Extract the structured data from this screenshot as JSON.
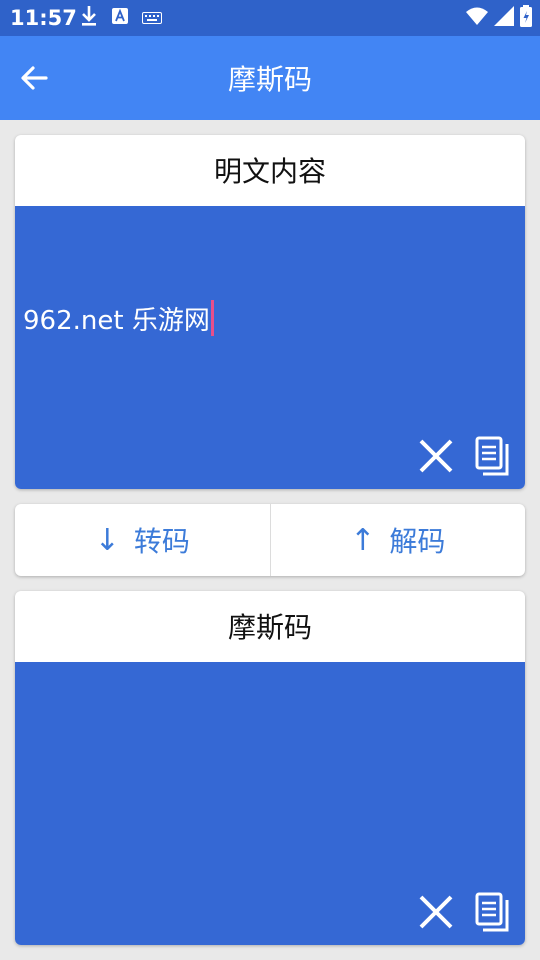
{
  "status_bar": {
    "time": "11:57",
    "icons": [
      "download-icon",
      "font-icon",
      "keyboard-icon",
      "wifi-icon",
      "signal-icon",
      "battery-icon"
    ]
  },
  "app_bar": {
    "title": "摩斯码",
    "back_icon": "back-arrow-icon"
  },
  "plain_card": {
    "title": "明文内容",
    "text": "962.net 乐游网",
    "clear_icon": "close-icon",
    "copy_icon": "copy-icon"
  },
  "actions": {
    "encode_arrow": "↓",
    "encode_label": "转码",
    "decode_arrow": "↑",
    "decode_label": "解码"
  },
  "morse_card": {
    "title": "摩斯码",
    "text": "",
    "clear_icon": "close-icon",
    "copy_icon": "copy-icon"
  },
  "colors": {
    "status_bar": "#2f62c9",
    "app_bar": "#4285f4",
    "text_area": "#3568d4",
    "button_text": "#3c7bd9",
    "caret": "#e64f8b"
  }
}
